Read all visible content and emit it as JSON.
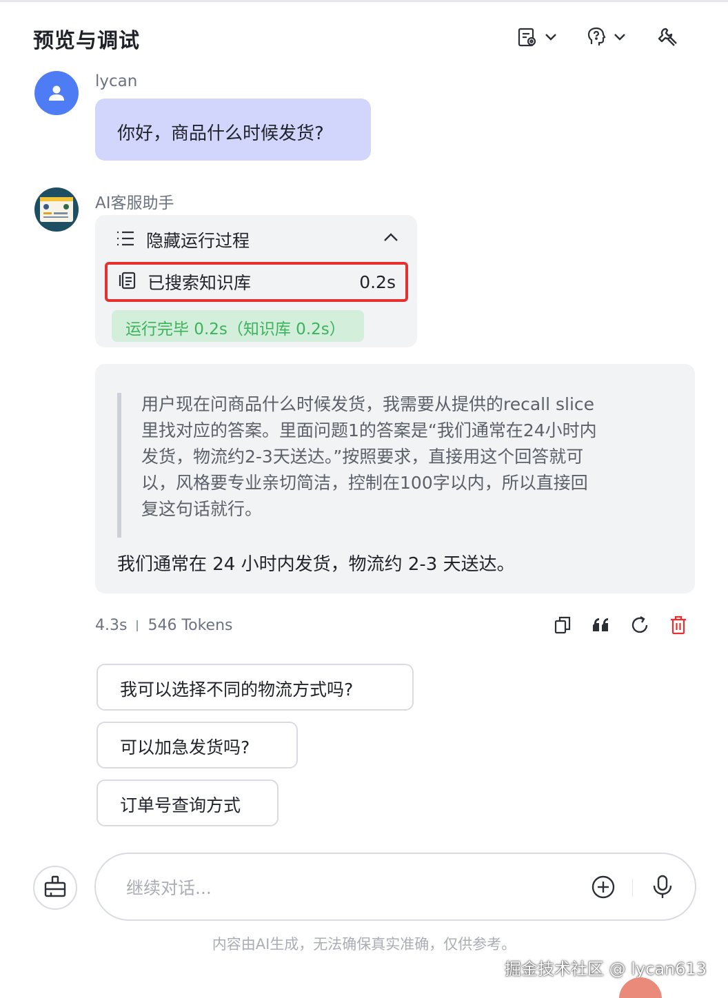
{
  "header": {
    "title": "预览与调试",
    "icons": [
      "config-file-icon",
      "chevron-down-icon",
      "voice-person-icon",
      "chevron-down-icon",
      "wrench-icon"
    ]
  },
  "user_message": {
    "username": "lycan",
    "text": "你好，商品什么时候发货?"
  },
  "bot_message": {
    "name": "AI客服助手",
    "process": {
      "toggle_label": "隐藏运行过程",
      "step_label": "已搜索知识库",
      "step_time": "0.2s",
      "done_label": "运行完毕 0.2s（知识库 0.2s）"
    },
    "thinking_lines": [
      "用户现在问商品什么时候发货，我需要从提供的recall slice",
      "里找对应的答案。里面问题1的答案是“我们通常在24小时内",
      "发货，物流约2-3天送达。”按照要求，直接用这个回答就可",
      "以，风格要专业亲切简洁，控制在100字以内，所以直接回",
      "复这句话就行。"
    ],
    "answer": "我们通常在 24 小时内发货，物流约 2-3 天送达。",
    "meta_time": "4.3s",
    "meta_tokens": "546 Tokens"
  },
  "suggestions": [
    "我可以选择不同的物流方式吗?",
    "可以加急发货吗?",
    "订单号查询方式"
  ],
  "input": {
    "placeholder": "继续对话..."
  },
  "disclaimer": "内容由AI生成，无法确保真实准确，仅供参考。",
  "watermark": "掘金技术社区 @ lycan613",
  "colors": {
    "user_bubble": "#d2d6fc",
    "user_avatar": "#4d7cf5",
    "card_bg": "#f2f3f5",
    "highlight_border": "#e5302f",
    "done_bg": "#d3eedb",
    "done_text": "#3bb35a",
    "delete_icon": "#e5302f"
  }
}
